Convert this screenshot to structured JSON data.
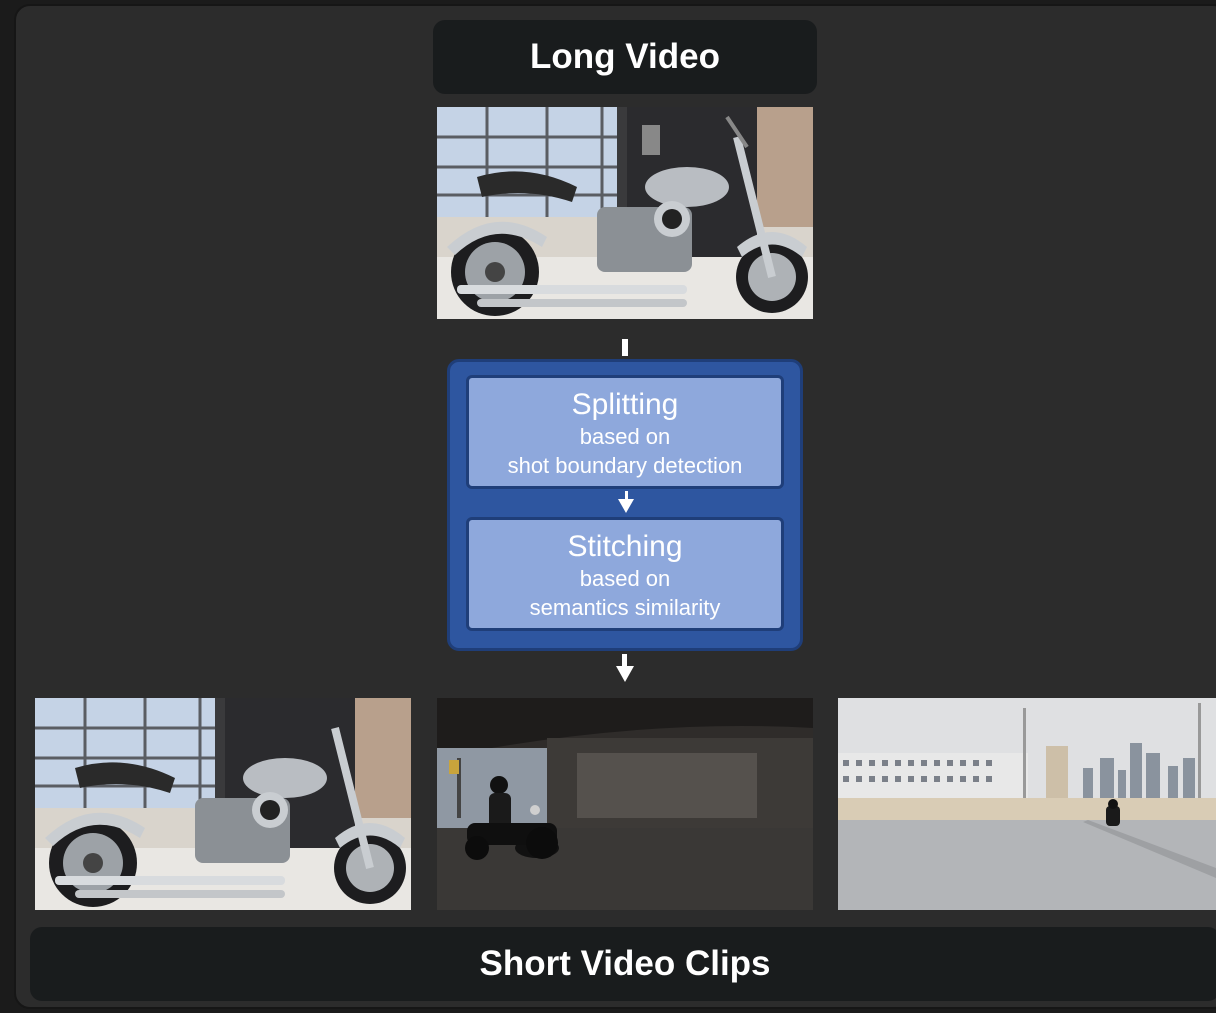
{
  "diagram": {
    "input_title": "Long Video",
    "output_title": "Short Video Clips",
    "steps": [
      {
        "title": "Splitting",
        "sub1": "based on",
        "sub2": "shot boundary detection"
      },
      {
        "title": "Stitching",
        "sub1": "based on",
        "sub2": "semantics similarity"
      }
    ],
    "colors": {
      "panel_bg": "#2c2c2c",
      "title_box_bg": "#191c1d",
      "process_outer": "#2e56a0",
      "process_border": "#1f3e79",
      "step_fill": "#8ea8dc",
      "text": "#ffffff"
    },
    "images": [
      {
        "name": "long-video-frame",
        "depicts": "motorcycle"
      },
      {
        "name": "clip-motorcycle-showroom",
        "depicts": "motorcycle"
      },
      {
        "name": "clip-rider-under-bridge",
        "depicts": "motorcycle-rider"
      },
      {
        "name": "clip-rider-on-bridge-city",
        "depicts": "city-bridge"
      }
    ]
  }
}
